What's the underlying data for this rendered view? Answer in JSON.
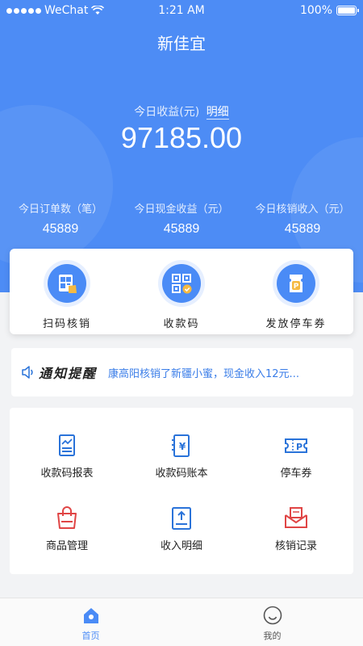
{
  "status_bar": {
    "carrier": "WeChat",
    "time": "1:21 AM",
    "battery": "100%"
  },
  "header": {
    "title": "新佳宜"
  },
  "summary": {
    "income_label": "今日收益(元)",
    "detail_link": "明细",
    "income_value": "97185.00"
  },
  "stats": [
    {
      "label": "今日订单数（笔）",
      "value": "45889"
    },
    {
      "label": "今日现金收益（元）",
      "value": "45889"
    },
    {
      "label": "今日核销收入（元）",
      "value": "45889"
    }
  ],
  "actions": [
    {
      "label": "扫码核销",
      "icon": "scan-verify-icon"
    },
    {
      "label": "收款码",
      "icon": "qr-code-icon"
    },
    {
      "label": "发放停车券",
      "icon": "parking-ticket-icon"
    }
  ],
  "notice": {
    "title": "通知提醒",
    "text": "康高阳核销了新疆小蜜，现金收入12元..."
  },
  "menu": [
    {
      "label": "收款码报表",
      "icon": "report-icon",
      "color": "#2a73d9"
    },
    {
      "label": "收款码账本",
      "icon": "ledger-icon",
      "color": "#2a73d9"
    },
    {
      "label": "停车券",
      "icon": "parking-coupon-icon",
      "color": "#2a73d9"
    },
    {
      "label": "商品管理",
      "icon": "shopping-bag-icon",
      "color": "#e04545"
    },
    {
      "label": "收入明细",
      "icon": "income-detail-icon",
      "color": "#2a73d9"
    },
    {
      "label": "核销记录",
      "icon": "mail-record-icon",
      "color": "#e04545"
    }
  ],
  "tabbar": [
    {
      "label": "首页",
      "icon": "home-icon",
      "active": true
    },
    {
      "label": "我的",
      "icon": "smile-icon",
      "active": false
    }
  ],
  "colors": {
    "primary": "#4d8cf5",
    "link": "#3a7de8",
    "accent_red": "#e04545"
  }
}
